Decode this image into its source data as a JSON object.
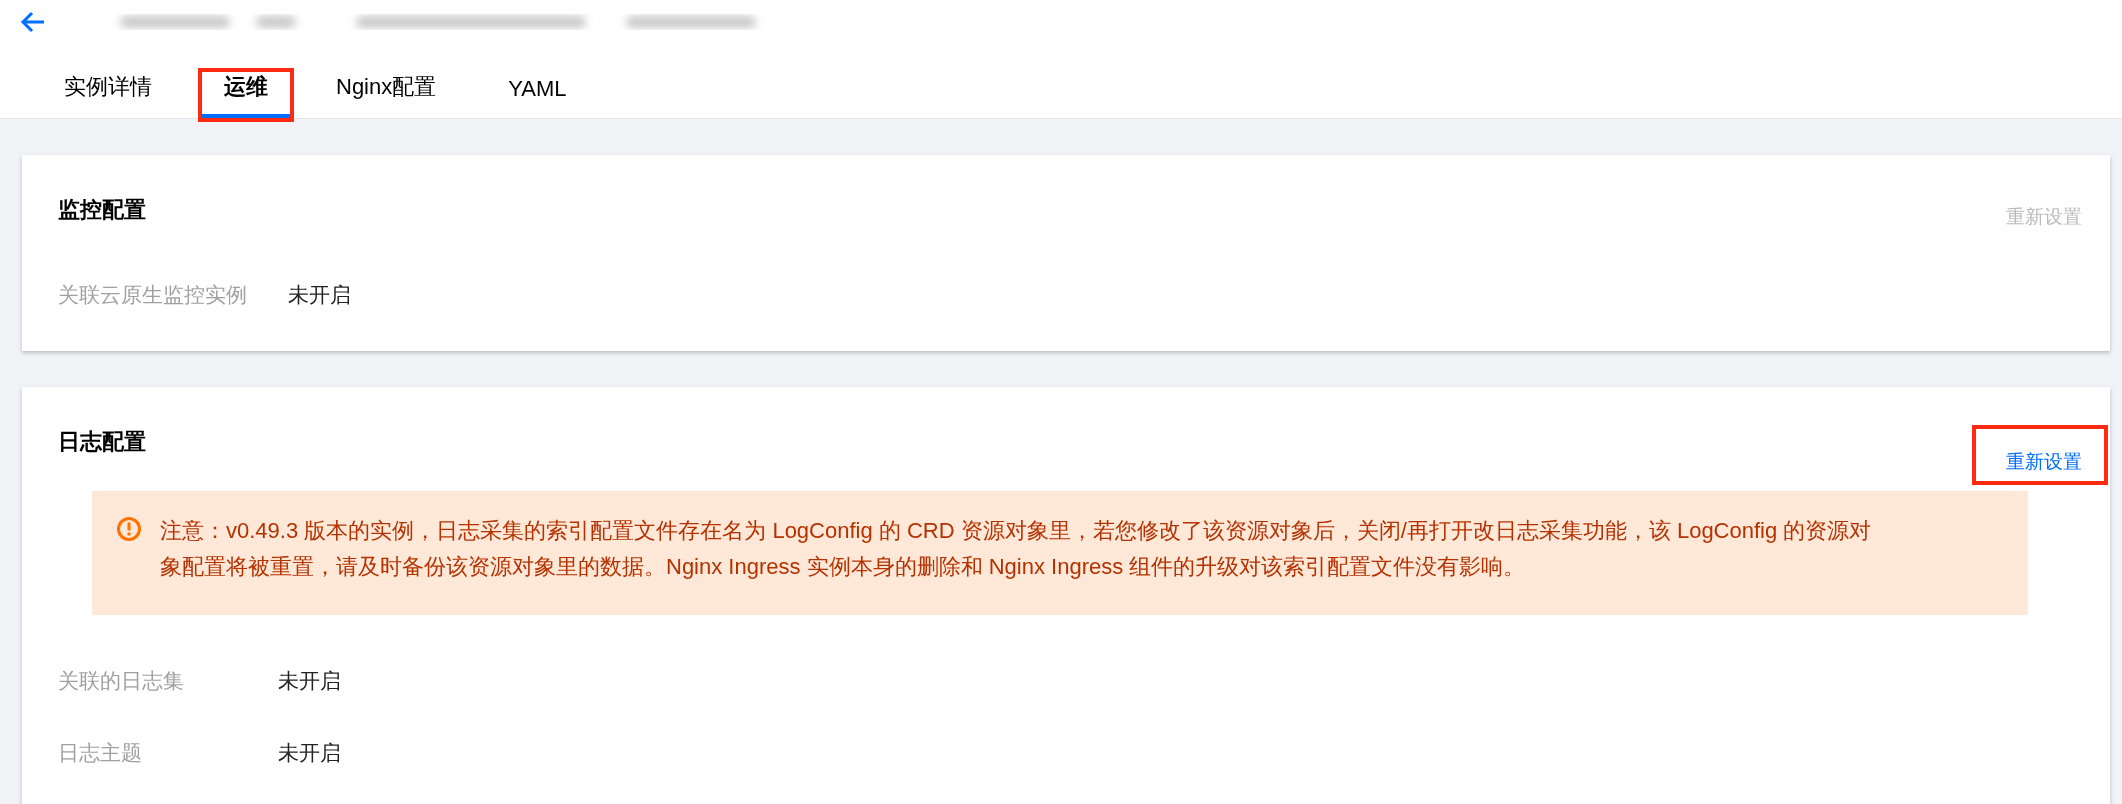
{
  "tabs": [
    {
      "label": "实例详情",
      "selected": false,
      "highlighted": false
    },
    {
      "label": "运维",
      "selected": true,
      "highlighted": true
    },
    {
      "label": "Nginx配置",
      "selected": false,
      "highlighted": false
    },
    {
      "label": "YAML",
      "selected": false,
      "highlighted": false
    }
  ],
  "sections": [
    {
      "title": "监控配置",
      "reset_button": {
        "label": "重新设置",
        "disabled": true,
        "highlighted": false
      },
      "fields": [
        {
          "label": "关联云原生监控实例",
          "value": "未开启"
        }
      ]
    },
    {
      "title": "日志配置",
      "reset_button": {
        "label": "重新设置",
        "disabled": false,
        "highlighted": true
      },
      "notice": {
        "kind": "warning",
        "text": "注意：v0.49.3 版本的实例，日志采集的索引配置文件存在名为 LogConfig 的 CRD 资源对象里，若您修改了该资源对象后，关闭/再打开改日志采集功能，该 LogConfig 的资源对象配置将被重置，请及时备份该资源对象里的数据。Nginx Ingress 实例本身的删除和 Nginx Ingress 组件的升级对该索引配置文件没有影响。"
      },
      "fields": [
        {
          "label": "关联的日志集",
          "value": "未开启"
        },
        {
          "label": "日志主题",
          "value": "未开启"
        }
      ]
    }
  ]
}
